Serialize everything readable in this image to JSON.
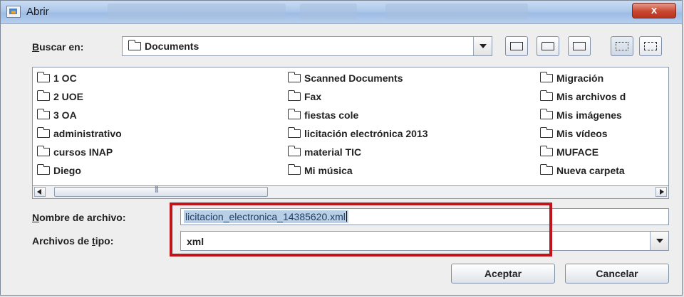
{
  "window": {
    "title": "Abrir",
    "close_glyph": "x"
  },
  "look_in": {
    "label_prefix": "B",
    "label_rest": "uscar en:",
    "value": "Documents"
  },
  "icons": {
    "app": "java-cup-icon",
    "folder": "folder-icon",
    "up": "up-folder-icon",
    "home": "home-icon",
    "new_folder": "new-folder-icon",
    "list_view": "list-view-icon",
    "details_view": "details-view-icon"
  },
  "files": {
    "col1": [
      "1 OC",
      "2 UOE",
      "3 OA",
      "administrativo",
      "cursos INAP",
      "Diego"
    ],
    "col2": [
      "Scanned Documents",
      "Fax",
      "fiestas cole",
      "licitación electrónica 2013",
      "material TIC",
      "Mi música"
    ],
    "col3": [
      "Migración",
      "Mis archivos d",
      "Mis imágenes",
      "Mis vídeos",
      "MUFACE",
      "Nueva carpeta"
    ]
  },
  "filename": {
    "label_prefix": "N",
    "label_rest": "ombre de archivo:",
    "value": "licitacion_electronica_14385620.xml"
  },
  "filetype": {
    "label_before": "Archivos de ",
    "label_u": "t",
    "label_after": "ipo:",
    "value": "xml"
  },
  "buttons": {
    "accept": "Aceptar",
    "cancel": "Cancelar"
  },
  "colors": {
    "highlight": "#c0141c",
    "selection": "#b8cfe5"
  }
}
